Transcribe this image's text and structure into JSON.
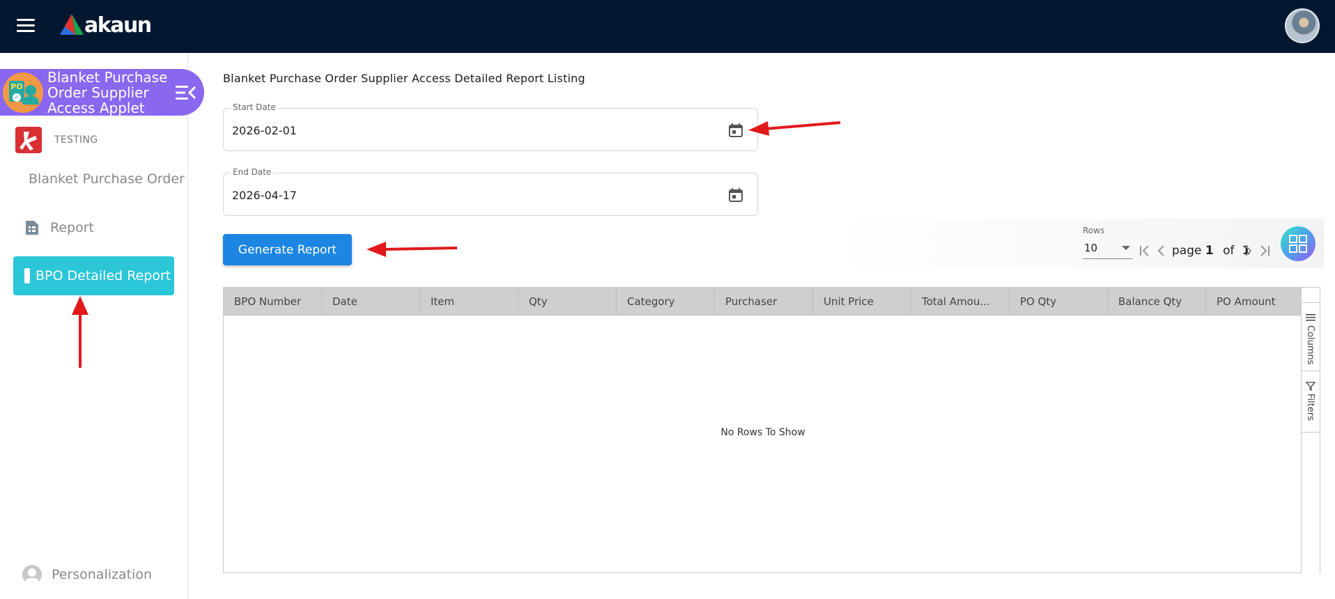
{
  "topbar": {
    "logo_text": "akaun"
  },
  "sidebar": {
    "applet_title": "Blanket Purchase Order Supplier Access Applet",
    "applet_badge_text": "PO",
    "company_label": "TESTING",
    "items": [
      {
        "label": "Blanket Purchase Order"
      },
      {
        "label": "Report"
      },
      {
        "label": "BPO Detailed Report"
      }
    ],
    "personalization_label": "Personalization"
  },
  "main": {
    "title": "Blanket Purchase Order Supplier Access Detailed Report Listing",
    "start_date": {
      "label": "Start Date",
      "value": "2026-02-01"
    },
    "end_date": {
      "label": "End Date",
      "value": "2026-04-17"
    },
    "generate_label": "Generate Report"
  },
  "pagination": {
    "rows_label": "Rows",
    "rows_value": "10",
    "page_word": "page",
    "current_page": "1",
    "of_word": "of",
    "total_pages": "1"
  },
  "table": {
    "columns": [
      "BPO Number",
      "Date",
      "Item",
      "Qty",
      "Category",
      "Purchaser",
      "Unit Price",
      "Total Amou...",
      "PO Qty",
      "Balance Qty",
      "PO Amount"
    ],
    "empty_text": "No Rows To Show",
    "side_tabs": [
      "Columns",
      "Filters"
    ]
  },
  "colors": {
    "topbar": "#031830",
    "applet_header": "#8a67ef",
    "active_nav": "#2bc6d8",
    "primary_button": "#1d86e2",
    "annotation_arrow": "#e0191b"
  },
  "icons": [
    "hamburger-menu-icon",
    "akaun-logo-icon",
    "user-avatar",
    "collapse-sidebar-icon",
    "company-logo-icon",
    "report-icon",
    "calendar-icon",
    "first-page-icon",
    "previous-page-icon",
    "next-page-icon",
    "last-page-icon",
    "grid-view-icon",
    "columns-icon",
    "filter-icon",
    "person-icon"
  ]
}
